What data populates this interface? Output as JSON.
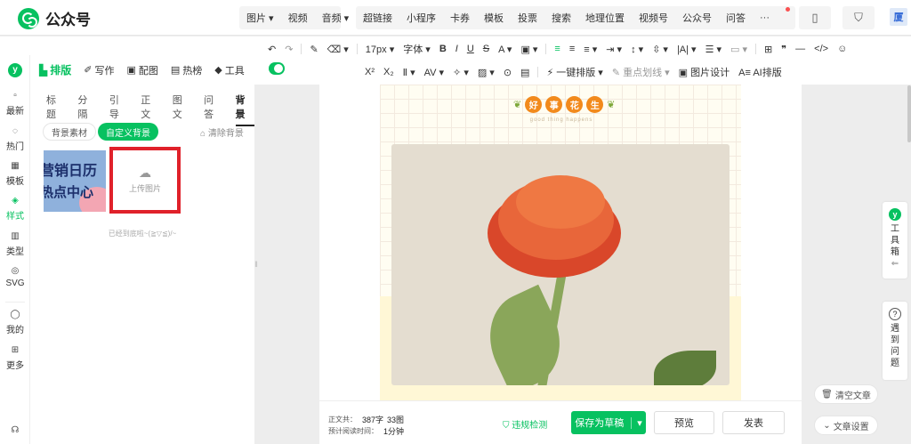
{
  "app": {
    "title": "公众号"
  },
  "insert_menu": {
    "media": [
      "图片",
      "视频",
      "音频"
    ],
    "items": [
      "超链接",
      "小程序",
      "卡券",
      "模板",
      "投票",
      "搜索",
      "地理位置",
      "视频号",
      "公众号",
      "问答"
    ],
    "more": "···"
  },
  "toolbar": {
    "font_size": "17px",
    "font_family": "字体",
    "one_key_layout": "一键排版",
    "highlight": "重点划线",
    "image_design": "图片设计",
    "ai_layout": "AI排版"
  },
  "leftnav": [
    {
      "label": "最新",
      "icon": "latest-icon"
    },
    {
      "label": "热门",
      "icon": "hot-icon"
    },
    {
      "label": "模板",
      "icon": "template-icon"
    },
    {
      "label": "样式",
      "icon": "style-icon",
      "active": true
    },
    {
      "label": "类型",
      "icon": "type-icon"
    },
    {
      "label": "SVG",
      "icon": "svg-icon"
    },
    {
      "label": "我的",
      "icon": "my-icon"
    },
    {
      "label": "更多",
      "icon": "more-icon"
    }
  ],
  "panel": {
    "tabs": [
      "排版",
      "写作",
      "配图",
      "热榜",
      "工具"
    ],
    "subtabs": [
      "标题",
      "分隔",
      "引导",
      "正文",
      "图文",
      "问答",
      "背景"
    ],
    "bg_material": "背景素材",
    "custom_bg": "自定义背景",
    "clear_bg": "清除背景",
    "thumb_line1": "营销日历",
    "thumb_line2": "热点中心",
    "upload_label": "上传图片",
    "end_note": "已经到底啦~(≧▽≦)/~"
  },
  "article": {
    "title_chars": [
      "好",
      "事",
      "花",
      "生"
    ],
    "title_subtitle": "good thing happens"
  },
  "status": {
    "word_label": "正文共：",
    "word_count": "387字",
    "image_count": "33图",
    "read_label": "预计阅读时间：",
    "read_time": "1分钟",
    "violation_check": "违规检测",
    "save_draft": "保存为草稿",
    "preview": "预览",
    "publish": "发表"
  },
  "right": {
    "toolbox": [
      "工",
      "具",
      "箱"
    ],
    "faq": [
      "遇",
      "到",
      "问",
      "题"
    ],
    "clear_article": "清空文章",
    "article_settings": "文章设置"
  },
  "colors": {
    "accent": "#07c160",
    "highlight_border": "#e0212a",
    "title_bubble": "#f28a1c"
  }
}
